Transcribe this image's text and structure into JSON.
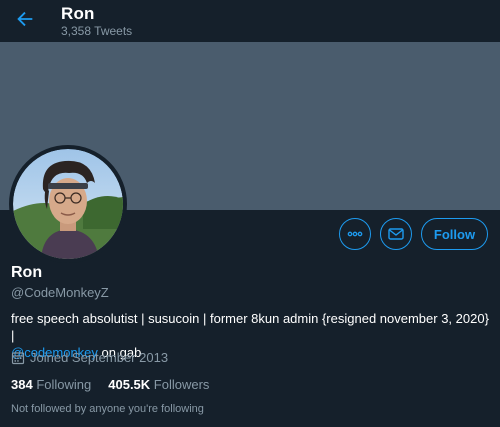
{
  "header": {
    "name": "Ron",
    "tweet_count": "3,358 Tweets"
  },
  "icons": {
    "back": "back-arrow-icon",
    "more": "more-options-icon",
    "message": "envelope-icon",
    "calendar": "calendar-icon"
  },
  "colors": {
    "background": "#15202b",
    "banner": "#4a5c6d",
    "accent": "#1d9bf0",
    "secondary_text": "#8899a6"
  },
  "actions": {
    "follow_label": "Follow"
  },
  "profile": {
    "name": "Ron",
    "handle": "@CodeMonkeyZ",
    "bio_text": "free speech absolutist | susucoin | former 8kun admin {resigned november 3, 2020} |",
    "bio_link": "@codemonkey",
    "bio_suffix": "on gab",
    "joined": "Joined September 2013"
  },
  "stats": {
    "following_count": "384",
    "following_label": "Following",
    "followers_count": "405.5K",
    "followers_label": "Followers"
  },
  "footer": {
    "not_followed": "Not followed by anyone you're following"
  }
}
